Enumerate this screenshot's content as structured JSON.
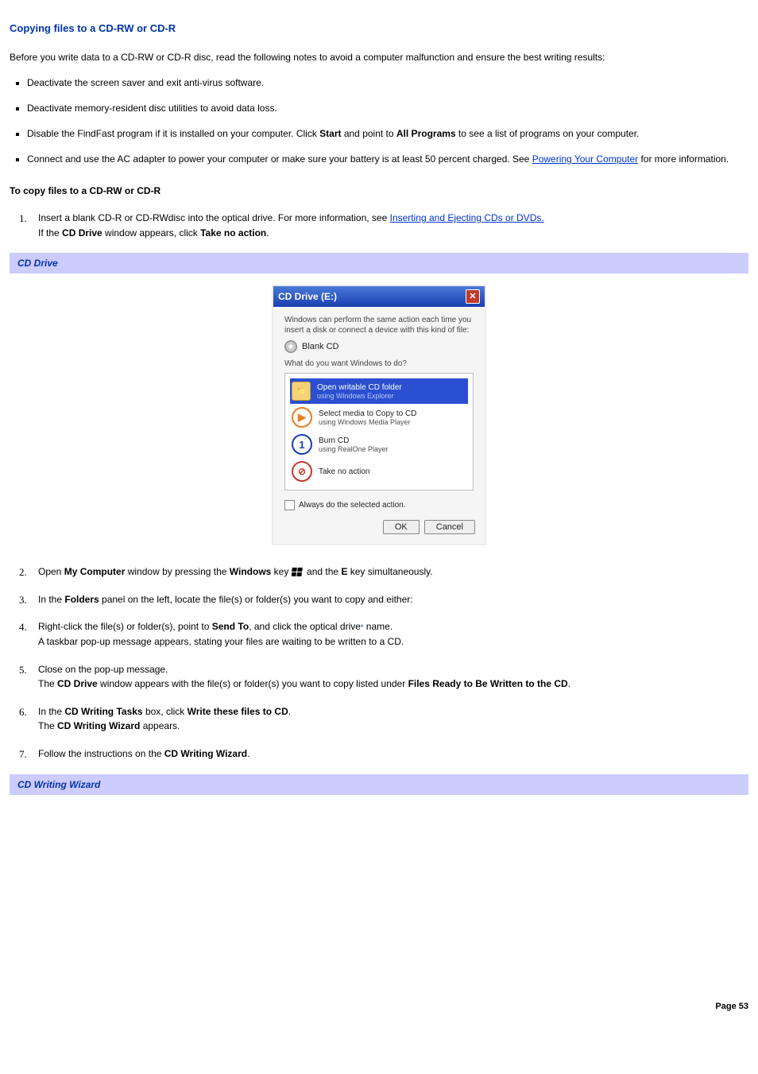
{
  "heading_main": "Copying files to a CD-RW or CD-R",
  "intro": "Before you write data to a CD-RW or CD-R disc, read the following notes to avoid a computer malfunction and ensure the best writing results:",
  "bullets": {
    "b1": "Deactivate the screen saver and exit anti-virus software.",
    "b2": "Deactivate memory-resident disc utilities to avoid data loss.",
    "b3a": "Disable the FindFast program if it is installed on your computer. Click ",
    "b3_bold1": "Start",
    "b3b": " and point to ",
    "b3_bold2": "All Programs",
    "b3c": " to see a list of programs on your computer.",
    "b4a": "Connect and use the AC adapter to power your computer or make sure your battery is at least 50 percent charged. See ",
    "b4_link": "Powering Your Computer",
    "b4b": " for more information."
  },
  "sub_heading": "To copy files to a CD-RW or CD-R",
  "steps": {
    "s1_num": "1.",
    "s1a": "Insert a blank CD-R or CD-RWdisc into the optical drive. For more information, see ",
    "s1_link": "Inserting and Ejecting CDs or DVDs.",
    "s1b_a": "If the ",
    "s1b_bold1": "CD Drive",
    "s1b_b": " window appears, click ",
    "s1b_bold2": "Take no action",
    "s1b_c": ".",
    "caption1": "CD Drive",
    "s2_num": "2.",
    "s2a": "Open ",
    "s2_bold1": "My Computer",
    "s2b": " window by pressing the ",
    "s2_bold2": "Windows",
    "s2c": " key ",
    "s2d": " and the ",
    "s2_bold3": "E",
    "s2e": " key simultaneously.",
    "s3_num": "3.",
    "s3a": "In the ",
    "s3_bold1": "Folders",
    "s3b": " panel on the left, locate the file(s) or folder(s) you want to copy and either:",
    "s4_num": "4.",
    "s4a": "Right-click the file(s) or folder(s), point to ",
    "s4_bold1": "Send To",
    "s4b": ", and click the optical drive",
    "s4_ref": "*",
    "s4c": " name.",
    "s4_line2": "A taskbar pop-up message appears, stating your files are waiting to be written to a CD.",
    "s5_num": "5.",
    "s5_line1": "Close on the pop-up message.",
    "s5a": "The ",
    "s5_bold1": "CD Drive",
    "s5b": " window appears with the file(s) or folder(s) you want to copy listed under ",
    "s5_bold2": "Files Ready to Be Written to the CD",
    "s5c": ".",
    "s6_num": "6.",
    "s6a": "In the ",
    "s6_bold1": "CD Writing Tasks",
    "s6b": " box, click ",
    "s6_bold2": "Write these files to CD",
    "s6c": ".",
    "s6d": "The ",
    "s6_bold3": "CD Writing Wizard",
    "s6e": " appears.",
    "s7_num": "7.",
    "s7a": "Follow the instructions on the ",
    "s7_bold1": "CD Writing Wizard",
    "s7b": ".",
    "caption2": "CD Writing Wizard"
  },
  "dialog": {
    "title": "CD Drive (E:)",
    "msg": "Windows can perform the same action each time you insert a disk or connect a device with this kind of file:",
    "media_label": "Blank CD",
    "question": "What do you want Windows to do?",
    "opt1_t1": "Open writable CD folder",
    "opt1_t2": "using Windows Explorer",
    "opt2_t1": "Select media to Copy to CD",
    "opt2_t2": "using Windows Media Player",
    "opt3_t1": "Burn CD",
    "opt3_t2": "using RealOne Player",
    "opt4_t1": "Take no action",
    "check_label": "Always do the selected action.",
    "btn_ok": "OK",
    "btn_cancel": "Cancel"
  },
  "page_num": "Page 53"
}
